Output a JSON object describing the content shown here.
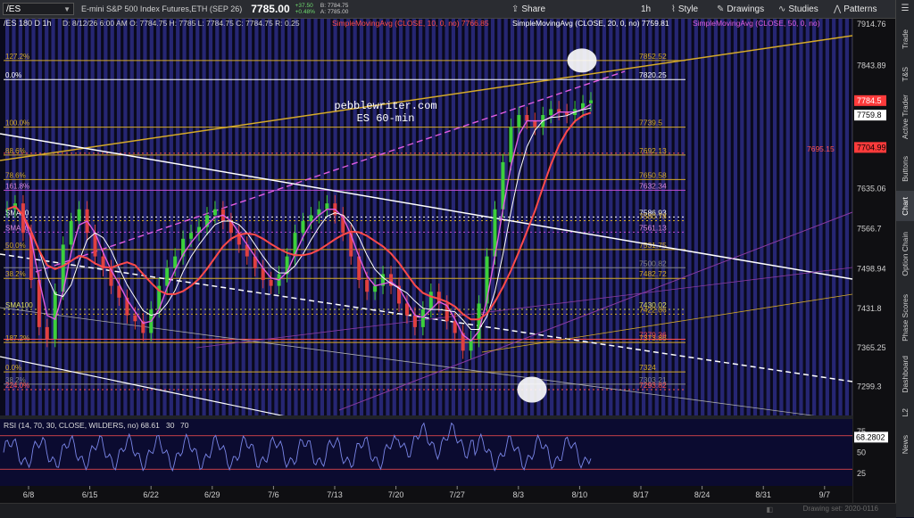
{
  "header": {
    "symbol": "/ES",
    "description": "E-mini S&P 500 Index Futures,ETH (SEP 26)",
    "last": "7785.00",
    "change": "+37.50",
    "change_pct": "+0.48%",
    "bid": "B: 7784.75",
    "ask": "A: 7785.00",
    "buttons": {
      "share": "Share",
      "timeframe": "1h",
      "style": "Style",
      "drawings": "Drawings",
      "studies": "Studies",
      "patterns": "Patterns"
    }
  },
  "sidebar": [
    "Trade",
    "T&S",
    "Active Trader",
    "Buttons",
    "Chart",
    "Option Chain",
    "Phase Scores",
    "Dashboard",
    "L2",
    "News"
  ],
  "watermark": "Drawing set: 2020-0116",
  "chart_data": {
    "type": "candlestick",
    "title": "/ES 180 D 1h",
    "ohlc": "D: 8/12/26 6:00 AM  O: 7784.75  H: 7785  L: 7784.75  C: 7784.75  R: 0.25",
    "studies": [
      {
        "name": "SimpleMovingAvg (CLOSE, 10, 0, no)",
        "value": "7766.85",
        "color": "#ff4a4a"
      },
      {
        "name": "SimpleMovingAvg (CLOSE, 20, 0, no)",
        "value": "7759.81",
        "color": "#ffffff"
      },
      {
        "name": "SimpleMovingAvg (CLOSE, 50, 0, no)",
        "value": "",
        "color": "#e05ce0"
      }
    ],
    "annotation": [
      "pebblewriter.com",
      "ES 60-min"
    ],
    "y_ticks": [
      7914.76,
      7843.89,
      7635.06,
      7566.7,
      7498.94,
      7431.8,
      7365.25,
      7299.3
    ],
    "ylim": [
      7250,
      7925
    ],
    "x_ticks": [
      "6/8",
      "6/15",
      "6/22",
      "6/29",
      "7/6",
      "7/13",
      "7/20",
      "7/27",
      "8/3",
      "8/10",
      "8/17",
      "8/24",
      "8/31",
      "9/7"
    ],
    "price_badges": [
      {
        "value": "7784.5",
        "bg": "#ff3b3b",
        "fg": "#ffffff"
      },
      {
        "value": "7759.8",
        "bg": "#ffffff",
        "fg": "#000000"
      },
      {
        "value": "7704.99",
        "bg": "#ff3b3b",
        "fg": "#000000"
      }
    ],
    "levels": [
      {
        "price": 7820.25,
        "label": "7820.25",
        "left": "0.0%",
        "color": "#ffffff",
        "dash": "",
        "lc": "#ffffff"
      },
      {
        "price": 7852.52,
        "label": "7852.52",
        "left": "127.2%",
        "color": "#d4a928",
        "dash": "",
        "lc": "#d4a928"
      },
      {
        "price": 7739.5,
        "label": "7739.5",
        "left": "100.0%",
        "color": "#d4a928",
        "dash": "",
        "lc": "#d4a928"
      },
      {
        "price": 7695.15,
        "label": "7695.15",
        "left": "",
        "color": "#ff5050",
        "dash": "2,3",
        "lc": "#ff5050"
      },
      {
        "price": 7692.13,
        "label": "7692.13",
        "left": "88.6%",
        "color": "#d4a928",
        "dash": "",
        "lc": "#d4a928"
      },
      {
        "price": 7650.58,
        "label": "7650.58",
        "left": "78.6%",
        "color": "#d4a928",
        "dash": "",
        "lc": "#d4a928"
      },
      {
        "price": 7632.34,
        "label": "7632.34",
        "left": "161.8%",
        "color": "#c04ccf",
        "dash": "",
        "lc": "#e08ae0"
      },
      {
        "price": 7586.93,
        "label": "7586.93",
        "left": "SMA20",
        "color": "#ffffff",
        "dash": "2,3",
        "lc": "#ffffff"
      },
      {
        "price": 7580.78,
        "label": "7580.78",
        "left": "",
        "color": "#d4a928",
        "dash": "2,3",
        "lc": "#d4a928"
      },
      {
        "price": 7561.13,
        "label": "7561.13",
        "left": "SMA50",
        "color": "#c04ccf",
        "dash": "2,3",
        "lc": "#e08ae0"
      },
      {
        "price": 7531.75,
        "label": "7531.75",
        "left": "50.0%",
        "color": "#d4a928",
        "dash": "",
        "lc": "#d4a928"
      },
      {
        "price": 7500.82,
        "label": "7500.82",
        "left": "",
        "color": "#888888",
        "dash": "",
        "lc": "#888888"
      },
      {
        "price": 7482.72,
        "label": "7482.72",
        "left": "38.2%",
        "color": "#d4a928",
        "dash": "",
        "lc": "#d4a928"
      },
      {
        "price": 7430.02,
        "label": "7430.02",
        "left": "SMA100",
        "color": "#c8c84c",
        "dash": "2,3",
        "lc": "#e0e05c"
      },
      {
        "price": 7422.06,
        "label": "7422.06",
        "left": "",
        "color": "#d4a928",
        "dash": "2,3",
        "lc": "#d4a928"
      },
      {
        "price": 7373.86,
        "label": "7373.86",
        "left": "187.2%",
        "color": "#d4a928",
        "dash": "",
        "lc": "#d4a928"
      },
      {
        "price": 7379.36,
        "label": "7379.36",
        "left": "",
        "color": "#ff5050",
        "dash": "",
        "lc": "#ff5050"
      },
      {
        "price": 7324,
        "label": "7324",
        "left": "0.0%",
        "color": "#d4a928",
        "dash": "",
        "lc": "#d4a928"
      },
      {
        "price": 7303.21,
        "label": "7303.21",
        "left": "38.2%",
        "color": "#888888",
        "dash": "",
        "lc": "#888888"
      },
      {
        "price": 7293.82,
        "label": "7293.82",
        "left": "224.0%",
        "color": "#ff5050",
        "dash": "2,3",
        "lc": "#ff5050"
      }
    ],
    "rsi": {
      "label": "RSI (14, 70, 30, CLOSE, WILDERS, no)",
      "value": "68.61",
      "ob": "30",
      "os": "70",
      "badge": "68.2802",
      "ticks": [
        75,
        50,
        25
      ]
    }
  }
}
